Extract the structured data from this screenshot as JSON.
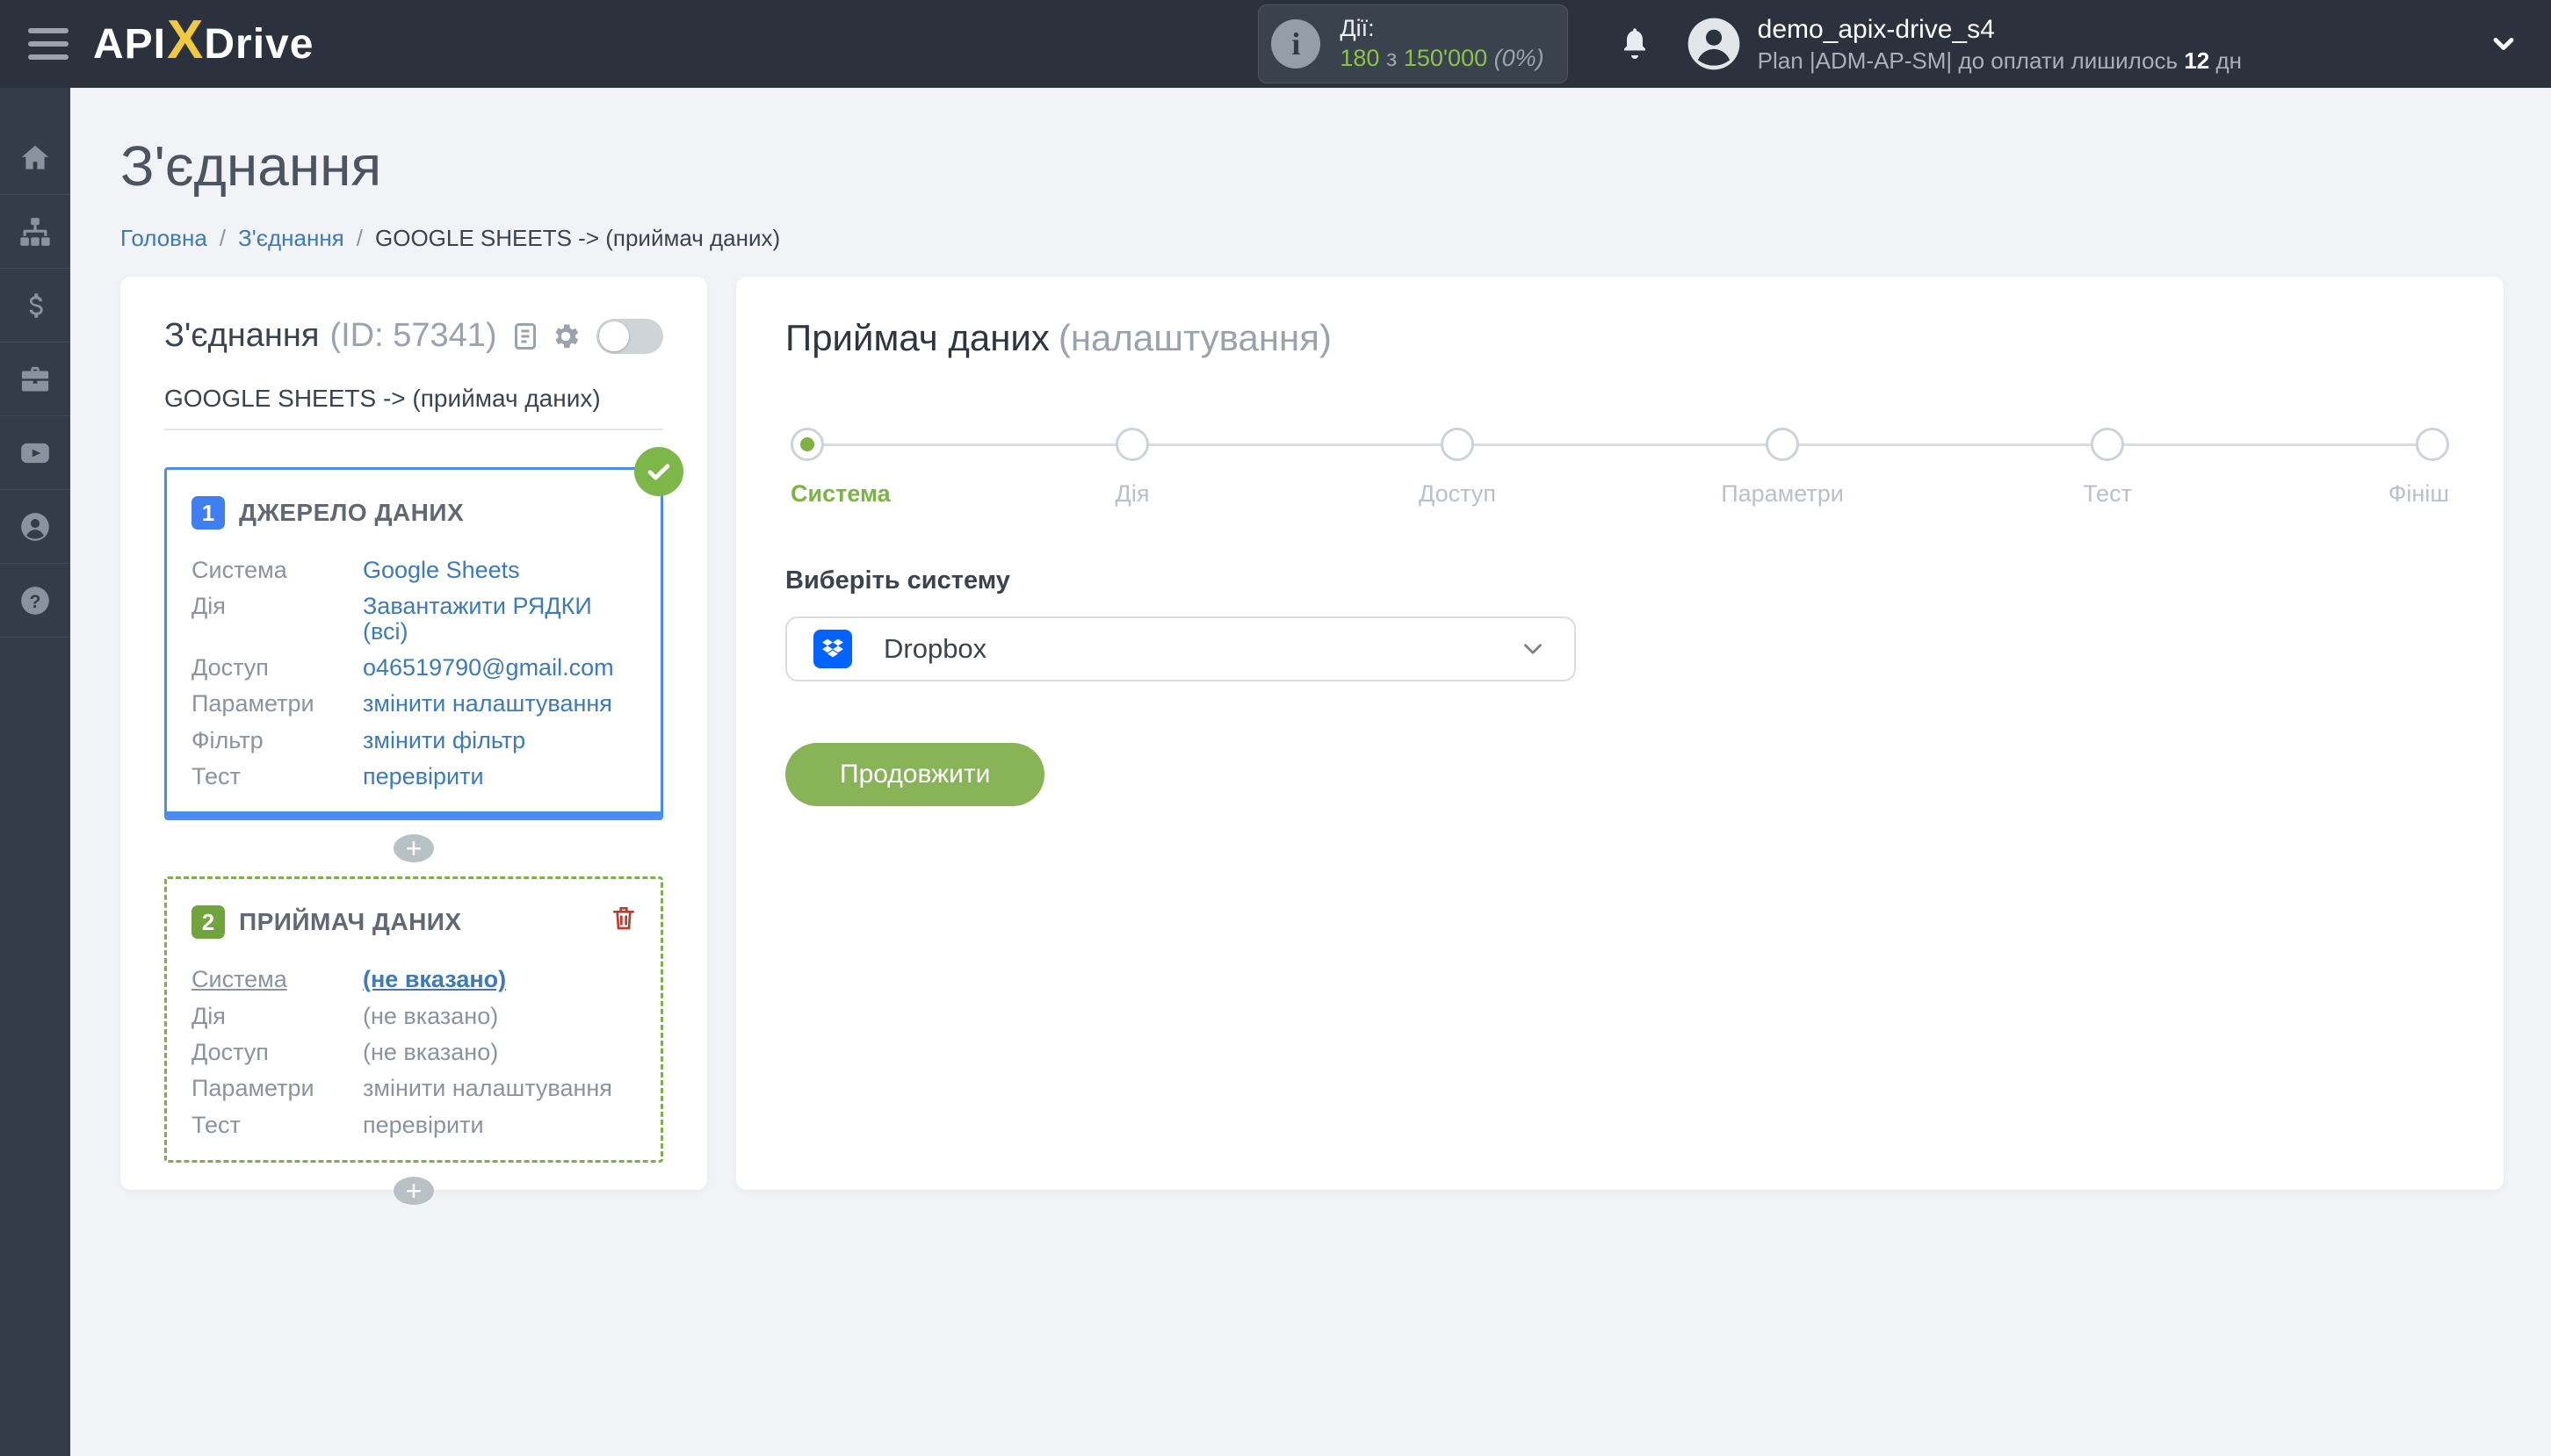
{
  "topbar": {
    "logo": {
      "part1": "API",
      "x": "X",
      "part2": "Drive"
    },
    "actions": {
      "label": "Дії:",
      "used": "180",
      "of_word": "з",
      "total": "150'000",
      "percent": "(0%)"
    },
    "user": {
      "name": "demo_apix-drive_s4",
      "plan_prefix": "Plan |ADM-AP-SM| до оплати лишилось",
      "days": "12",
      "days_suffix": "дн"
    }
  },
  "sidebar": {
    "items": [
      {
        "icon": "home-icon"
      },
      {
        "icon": "connections-icon"
      },
      {
        "icon": "billing-icon"
      },
      {
        "icon": "toolbox-icon"
      },
      {
        "icon": "video-icon"
      },
      {
        "icon": "account-icon"
      },
      {
        "icon": "help-icon"
      }
    ]
  },
  "page": {
    "title": "З'єднання",
    "breadcrumb": {
      "home": "Головна",
      "section": "З'єднання",
      "current": "GOOGLE SHEETS -> (приймач даних)"
    }
  },
  "connection_card": {
    "title": "З'єднання",
    "id_text": "(ID: 57341)",
    "subtitle": "GOOGLE SHEETS -> (приймач даних)",
    "add_step_label": "+",
    "source_block": {
      "number": "1",
      "title": "ДЖЕРЕЛО ДАНИХ",
      "rows": [
        {
          "label": "Система",
          "value": "Google Sheets"
        },
        {
          "label": "Дія",
          "value": "Завантажити РЯДКИ (всі)"
        },
        {
          "label": "Доступ",
          "value": "o46519790@gmail.com"
        },
        {
          "label": "Параметри",
          "value": "змінити налаштування"
        },
        {
          "label": "Фільтр",
          "value": "змінити фільтр"
        },
        {
          "label": "Тест",
          "value": "перевірити"
        }
      ]
    },
    "receiver_block": {
      "number": "2",
      "title": "ПРИЙМАЧ ДАНИХ",
      "rows": [
        {
          "label": "Система",
          "value": "(не вказано)"
        },
        {
          "label": "Дія",
          "value": "(не вказано)"
        },
        {
          "label": "Доступ",
          "value": "(не вказано)"
        },
        {
          "label": "Параметри",
          "value": "змінити налаштування"
        },
        {
          "label": "Тест",
          "value": "перевірити"
        }
      ]
    }
  },
  "settings_panel": {
    "title": "Приймач даних",
    "title_suffix": "(налаштування)",
    "steps": [
      {
        "label": "Система"
      },
      {
        "label": "Дія"
      },
      {
        "label": "Доступ"
      },
      {
        "label": "Параметри"
      },
      {
        "label": "Тест"
      },
      {
        "label": "Фініш"
      }
    ],
    "select_label": "Виберіть систему",
    "selected_system": "Dropbox",
    "continue_label": "Продовжити"
  },
  "colors": {
    "topbar_bg": "#2b323e",
    "sidebar_bg": "#343c4a",
    "accent_green": "#7cb342",
    "button_green": "#88b457",
    "link_blue": "#3a7abd",
    "source_border_blue": "#4a8cf0",
    "badge_blue": "#3f7ff2",
    "badge_green": "#6fa53c",
    "dropbox_blue": "#0062ff",
    "trash_red": "#c0392b",
    "counter_green": "#8bc34a",
    "logo_yellow": "#f2c83d",
    "page_bg": "#f2f3f7"
  }
}
